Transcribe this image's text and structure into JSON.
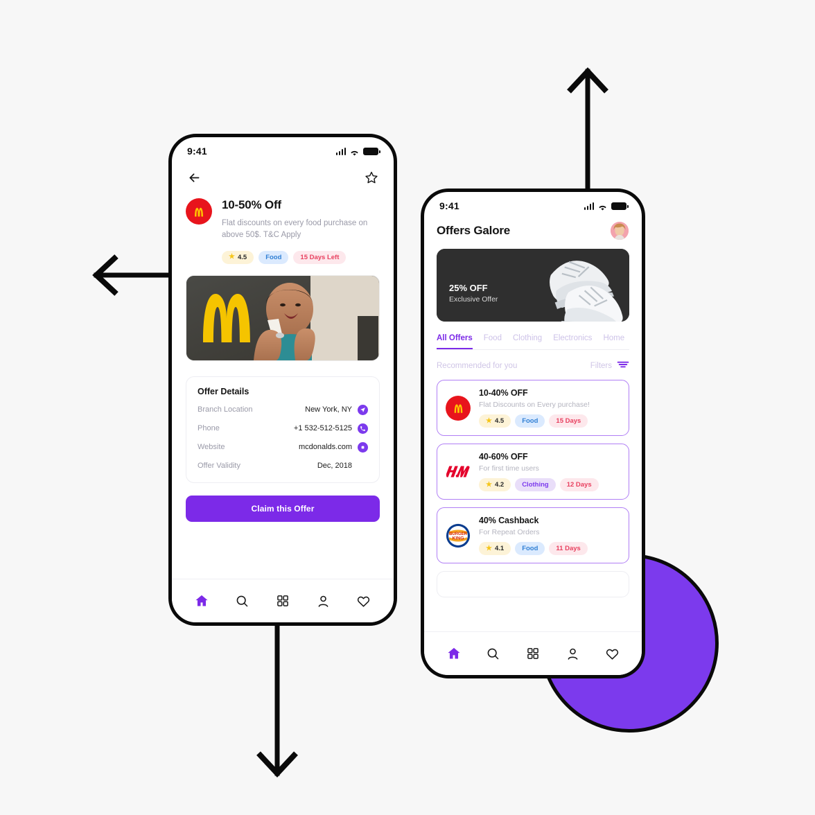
{
  "canvas": {
    "background": "#f7f7f7",
    "accent": "#7c2ae8",
    "circle_color": "#7c3aed"
  },
  "phone_detail": {
    "status": {
      "time": "9:41",
      "signal_icon": "cellular-signal-icon",
      "wifi_icon": "wifi-icon",
      "battery_icon": "battery-icon"
    },
    "topbar": {
      "back_icon": "back-arrow-icon",
      "favorite_icon": "star-outline-icon"
    },
    "offer": {
      "brand_logo": "mcdonalds-logo",
      "title": "10-50% Off",
      "description": "Flat discounts on every food purchase on above 50$. T&C Apply",
      "chips": [
        {
          "type": "rating",
          "star_icon": "star-icon",
          "label": "4.5"
        },
        {
          "type": "category-food",
          "label": "Food"
        },
        {
          "type": "days",
          "label": "15 Days Left"
        }
      ],
      "hero_image": "mcdonalds-storefront-photo"
    },
    "details": {
      "title": "Offer Details",
      "rows": [
        {
          "label": "Branch Location",
          "value": "New York, NY",
          "action_icon": "navigation-send-icon"
        },
        {
          "label": "Phone",
          "value": "+1 532-512-5125",
          "action_icon": "phone-call-icon"
        },
        {
          "label": "Website",
          "value": "mcdonalds.com",
          "action_icon": "globe-link-icon"
        },
        {
          "label": "Offer Validity",
          "value": "Dec, 2018",
          "action_icon": ""
        }
      ]
    },
    "cta": {
      "label": "Claim this Offer"
    },
    "tabbar": [
      {
        "icon": "home-icon",
        "name": "home",
        "active": true
      },
      {
        "icon": "search-icon",
        "name": "search",
        "active": false
      },
      {
        "icon": "grid-icon",
        "name": "categories",
        "active": false
      },
      {
        "icon": "person-icon",
        "name": "profile",
        "active": false
      },
      {
        "icon": "heart-icon",
        "name": "favorites",
        "active": false
      }
    ]
  },
  "phone_list": {
    "status": {
      "time": "9:41",
      "signal_icon": "cellular-signal-icon",
      "wifi_icon": "wifi-icon",
      "battery_icon": "battery-icon"
    },
    "header": {
      "title": "Offers Galore",
      "avatar": "user-avatar-photo"
    },
    "banner": {
      "title": "25% OFF",
      "subtitle": "Exclusive Offer",
      "image": "white-sneakers-photo"
    },
    "tabs": [
      {
        "label": "All Offers",
        "active": true
      },
      {
        "label": "Food",
        "active": false
      },
      {
        "label": "Clothing",
        "active": false
      },
      {
        "label": "Electronics",
        "active": false
      },
      {
        "label": "Home",
        "active": false
      }
    ],
    "list_header": {
      "left": "Recommended for you",
      "right": "Filters",
      "filter_icon": "filter-icon"
    },
    "offers": [
      {
        "brand_logo": "mcdonalds-logo",
        "title": "10-40% OFF",
        "subtitle": "Flat Discounts on Every purchase!",
        "chips": [
          {
            "type": "rating",
            "label": "4.5"
          },
          {
            "type": "category-food",
            "label": "Food"
          },
          {
            "type": "days",
            "label": "15 Days"
          }
        ]
      },
      {
        "brand_logo": "hm-logo",
        "title": "40-60% OFF",
        "subtitle": "For first time users",
        "chips": [
          {
            "type": "rating",
            "label": "4.2"
          },
          {
            "type": "category-clothing",
            "label": "Clothing"
          },
          {
            "type": "days",
            "label": "12 Days"
          }
        ]
      },
      {
        "brand_logo": "burger-king-logo",
        "title": "40% Cashback",
        "subtitle": "For Repeat Orders",
        "chips": [
          {
            "type": "rating",
            "label": "4.1"
          },
          {
            "type": "category-food",
            "label": "Food"
          },
          {
            "type": "days",
            "label": "11 Days"
          }
        ]
      }
    ],
    "tabbar": [
      {
        "icon": "home-icon",
        "name": "home",
        "active": true
      },
      {
        "icon": "search-icon",
        "name": "search",
        "active": false
      },
      {
        "icon": "grid-icon",
        "name": "categories",
        "active": false
      },
      {
        "icon": "person-icon",
        "name": "profile",
        "active": false
      },
      {
        "icon": "heart-icon",
        "name": "favorites",
        "active": false
      }
    ]
  },
  "annotations": {
    "arrow_left": "left-arrow",
    "arrow_up": "up-arrow",
    "arrow_down": "down-arrow"
  }
}
